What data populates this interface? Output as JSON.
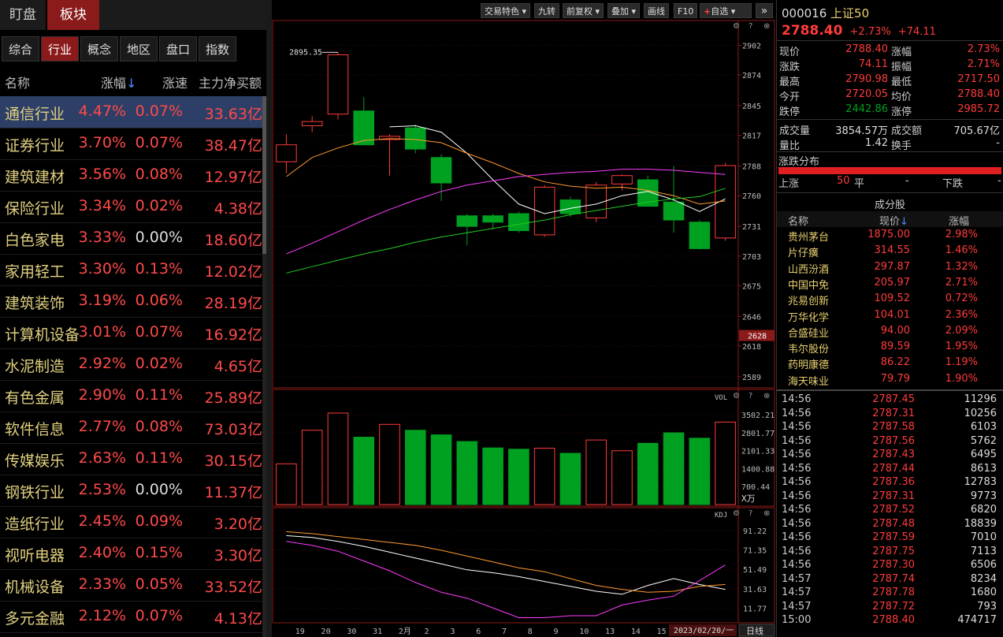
{
  "tabs": {
    "main": [
      {
        "label": "盯盘",
        "active": false
      },
      {
        "label": "板块",
        "active": true
      }
    ],
    "sub": [
      {
        "label": "综合",
        "active": false
      },
      {
        "label": "行业",
        "active": true
      },
      {
        "label": "概念",
        "active": false
      },
      {
        "label": "地区",
        "active": false
      },
      {
        "label": "盘口",
        "active": false
      },
      {
        "label": "指数",
        "active": false
      }
    ]
  },
  "sector_table": {
    "headers": {
      "name": "名称",
      "pct": "涨幅",
      "speed": "涨速",
      "flow": "主力净买额"
    },
    "sort_icon": "↓",
    "rows": [
      {
        "name": "通信行业",
        "pct": "4.47%",
        "speed": "0.07%",
        "flow": "33.63亿"
      },
      {
        "name": "证券行业",
        "pct": "3.70%",
        "speed": "0.07%",
        "flow": "38.47亿"
      },
      {
        "name": "建筑建材",
        "pct": "3.56%",
        "speed": "0.08%",
        "flow": "12.97亿"
      },
      {
        "name": "保险行业",
        "pct": "3.34%",
        "speed": "0.02%",
        "flow": "4.38亿"
      },
      {
        "name": "白色家电",
        "pct": "3.33%",
        "speed": "0.00%",
        "flow": "18.60亿"
      },
      {
        "name": "家用轻工",
        "pct": "3.30%",
        "speed": "0.13%",
        "flow": "12.02亿"
      },
      {
        "name": "建筑装饰",
        "pct": "3.19%",
        "speed": "0.06%",
        "flow": "28.19亿"
      },
      {
        "name": "计算机设备",
        "pct": "3.01%",
        "speed": "0.07%",
        "flow": "16.92亿"
      },
      {
        "name": "水泥制造",
        "pct": "2.92%",
        "speed": "0.02%",
        "flow": "4.65亿"
      },
      {
        "name": "有色金属",
        "pct": "2.90%",
        "speed": "0.11%",
        "flow": "25.89亿"
      },
      {
        "name": "软件信息",
        "pct": "2.77%",
        "speed": "0.08%",
        "flow": "73.03亿"
      },
      {
        "name": "传媒娱乐",
        "pct": "2.63%",
        "speed": "0.11%",
        "flow": "30.15亿"
      },
      {
        "name": "钢铁行业",
        "pct": "2.53%",
        "speed": "0.00%",
        "flow": "11.37亿"
      },
      {
        "name": "造纸行业",
        "pct": "2.45%",
        "speed": "0.09%",
        "flow": "3.20亿"
      },
      {
        "name": "视听电器",
        "pct": "2.40%",
        "speed": "0.15%",
        "flow": "3.30亿"
      },
      {
        "name": "机械设备",
        "pct": "2.33%",
        "speed": "0.05%",
        "flow": "33.52亿"
      },
      {
        "name": "多元金融",
        "pct": "2.12%",
        "speed": "0.07%",
        "flow": "4.13亿"
      }
    ]
  },
  "toolbar": {
    "buttons": [
      "交易特色",
      "九转",
      "前复权",
      "叠加",
      "画线",
      "F10"
    ],
    "add_watch": "自选",
    "expand_icon": "»"
  },
  "panel_icons": {
    "gear": "⚙",
    "help": "?",
    "close": "⊗"
  },
  "chart_data": {
    "type": "candlestick",
    "price_axis": {
      "ticks": [
        "2902",
        "2874",
        "2845",
        "2817",
        "2788",
        "2760",
        "2731",
        "2703",
        "2675",
        "2646",
        "2618",
        "2589"
      ],
      "ylim": [
        2580,
        2912
      ],
      "cursor_label": "2628"
    },
    "peak_label": "2895.35",
    "dates": [
      "19",
      "20",
      "30",
      "31",
      "2月",
      "2",
      "3",
      "6",
      "7",
      "8",
      "9",
      "10",
      "13",
      "14",
      "15",
      "2023/02/20/一"
    ],
    "candles": [
      {
        "o": 2792,
        "h": 2818,
        "l": 2781,
        "c": 2808
      },
      {
        "o": 2826,
        "h": 2835,
        "l": 2820,
        "c": 2830
      },
      {
        "o": 2837,
        "h": 2895.35,
        "l": 2832,
        "c": 2893
      },
      {
        "o": 2840,
        "h": 2853,
        "l": 2808,
        "c": 2808
      },
      {
        "o": 2813,
        "h": 2818,
        "l": 2779,
        "c": 2816
      },
      {
        "o": 2824,
        "h": 2827,
        "l": 2800,
        "c": 2804
      },
      {
        "o": 2796,
        "h": 2799,
        "l": 2755,
        "c": 2772
      },
      {
        "o": 2741,
        "h": 2743,
        "l": 2713,
        "c": 2731
      },
      {
        "o": 2741,
        "h": 2743,
        "l": 2728,
        "c": 2735
      },
      {
        "o": 2743,
        "h": 2745,
        "l": 2725,
        "c": 2727
      },
      {
        "o": 2723,
        "h": 2770,
        "l": 2721,
        "c": 2768
      },
      {
        "o": 2756,
        "h": 2759,
        "l": 2740,
        "c": 2743
      },
      {
        "o": 2739,
        "h": 2773,
        "l": 2735,
        "c": 2770
      },
      {
        "o": 2771,
        "h": 2780,
        "l": 2765,
        "c": 2779
      },
      {
        "o": 2775,
        "h": 2779,
        "l": 2750,
        "c": 2750
      },
      {
        "o": 2754,
        "h": 2788,
        "l": 2725,
        "c": 2737
      },
      {
        "o": 2735,
        "h": 2737,
        "l": 2709,
        "c": 2710
      },
      {
        "o": 2720.05,
        "h": 2790.98,
        "l": 2717.5,
        "c": 2788.4
      }
    ],
    "ma_lines": [
      {
        "color": "#ffffff",
        "values": [
          null,
          null,
          null,
          null,
          2825,
          2826,
          2820,
          2800,
          2775,
          2752,
          2743,
          2748,
          2752,
          2760,
          2764,
          2756,
          2745,
          2757
        ]
      },
      {
        "color": "#ff9a2e",
        "values": [
          2778,
          2796,
          2805,
          2812,
          2814,
          2813,
          2810,
          2800,
          2791,
          2781,
          2773,
          2769,
          2767,
          2768,
          2765,
          2760,
          2752,
          2755
        ]
      },
      {
        "color": "#ff3cff",
        "values": [
          2705,
          2715,
          2726,
          2737,
          2747,
          2756,
          2764,
          2770,
          2774,
          2778,
          2780,
          2782,
          2783,
          2785,
          2785,
          2784,
          2782,
          2780
        ]
      },
      {
        "color": "#22cc22",
        "values": [
          2687,
          2693,
          2699,
          2705,
          2710,
          2716,
          2721,
          2725,
          2729,
          2733,
          2737,
          2742,
          2746,
          2750,
          2754,
          2757,
          2759,
          2767
        ]
      }
    ],
    "volume": {
      "label": "VOL",
      "unit": "X万",
      "ticks": [
        "3502.21",
        "2801.77",
        "2101.33",
        "1400.88",
        "700.44"
      ],
      "ylim": [
        0,
        4000
      ],
      "values": [
        1590,
        2900,
        3570,
        2630,
        3130,
        2900,
        2720,
        2460,
        2210,
        2160,
        2200,
        2000,
        2520,
        2100,
        2390,
        2800,
        2590,
        3220
      ]
    },
    "kdj": {
      "label": "KDJ",
      "ticks": [
        "91.22",
        "71.35",
        "51.49",
        "31.63",
        "11.77"
      ],
      "ylim": [
        0,
        100
      ],
      "k": [
        86,
        84,
        80,
        75,
        69,
        63,
        57,
        51,
        48,
        44,
        39,
        34,
        29,
        26,
        35,
        42,
        36,
        31
      ],
      "d": [
        90,
        88,
        85,
        82,
        79,
        76,
        71,
        65,
        59,
        53,
        49,
        42,
        35,
        31,
        28,
        29,
        34,
        36
      ],
      "j": [
        80,
        76,
        70,
        60,
        50,
        38,
        28,
        22,
        12,
        2,
        2,
        4,
        4,
        15,
        20,
        24,
        40,
        56
      ]
    }
  },
  "footer": {
    "kline_type": "日线"
  },
  "quote": {
    "code": "000016",
    "name": "上证50",
    "price": "2788.40",
    "change_pct": "+2.73%",
    "change": "+74.11",
    "rows": [
      [
        "现价",
        "2788.40",
        "涨幅",
        "2.73%"
      ],
      [
        "涨跌",
        "74.11",
        "振幅",
        "2.71%"
      ],
      [
        "最高",
        "2790.98",
        "最低",
        "2717.50"
      ],
      [
        "今开",
        "2720.05",
        "均价",
        "2788.40"
      ],
      [
        "跌停",
        "2442.86",
        "涨停",
        "2985.72"
      ],
      [
        "成交量",
        "3854.57万",
        "成交额",
        "705.67亿"
      ],
      [
        "量比",
        "1.42",
        "换手",
        "-"
      ]
    ],
    "dist_title": "涨跌分布",
    "dist": {
      "up_label": "上涨",
      "up_count": "50",
      "flat_label": "平",
      "flat_count": "-",
      "down_label": "下跌",
      "down_count": "-"
    },
    "components_title": "成分股",
    "components_headers": {
      "name": "名称",
      "price": "现价",
      "pct": "涨幅"
    },
    "components": [
      {
        "name": "贵州茅台",
        "price": "1875.00",
        "pct": "2.98%"
      },
      {
        "name": "片仔癀",
        "price": "314.55",
        "pct": "1.46%"
      },
      {
        "name": "山西汾酒",
        "price": "297.87",
        "pct": "1.32%"
      },
      {
        "name": "中国中免",
        "price": "205.97",
        "pct": "2.71%"
      },
      {
        "name": "兆易创新",
        "price": "109.52",
        "pct": "0.72%"
      },
      {
        "name": "万华化学",
        "price": "104.01",
        "pct": "2.36%"
      },
      {
        "name": "合盛硅业",
        "price": "94.00",
        "pct": "2.09%"
      },
      {
        "name": "韦尔股份",
        "price": "89.59",
        "pct": "1.95%"
      },
      {
        "name": "药明康德",
        "price": "86.22",
        "pct": "1.19%"
      },
      {
        "name": "海天味业",
        "price": "79.79",
        "pct": "1.90%"
      }
    ],
    "ticks": [
      [
        "14:56",
        "2787.45",
        "11296"
      ],
      [
        "14:56",
        "2787.31",
        "10256"
      ],
      [
        "14:56",
        "2787.58",
        "6103"
      ],
      [
        "14:56",
        "2787.56",
        "5762"
      ],
      [
        "14:56",
        "2787.43",
        "6495"
      ],
      [
        "14:56",
        "2787.44",
        "8613"
      ],
      [
        "14:56",
        "2787.36",
        "12783"
      ],
      [
        "14:56",
        "2787.31",
        "9773"
      ],
      [
        "14:56",
        "2787.52",
        "6820"
      ],
      [
        "14:56",
        "2787.48",
        "18839"
      ],
      [
        "14:56",
        "2787.59",
        "7010"
      ],
      [
        "14:56",
        "2787.75",
        "7113"
      ],
      [
        "14:56",
        "2787.30",
        "6506"
      ],
      [
        "14:57",
        "2787.74",
        "8234"
      ],
      [
        "14:57",
        "2787.78",
        "1680"
      ],
      [
        "14:57",
        "2787.72",
        "793"
      ],
      [
        "15:00",
        "2788.40",
        "474717"
      ]
    ]
  },
  "colors": {
    "up": "#ff3b3b",
    "down": "#00a020",
    "accent": "#8b1a1a",
    "selected_row": "#2d3f66"
  }
}
